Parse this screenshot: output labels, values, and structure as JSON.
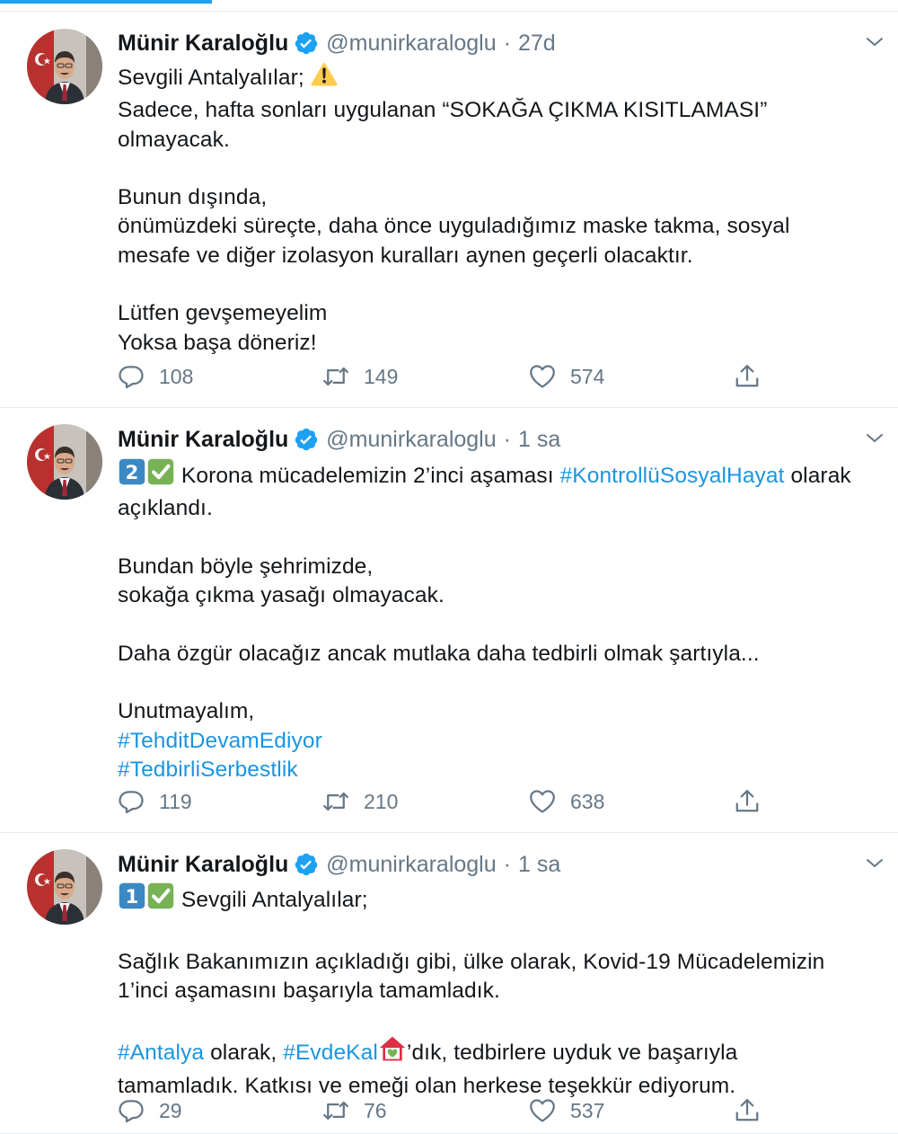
{
  "tweets": [
    {
      "name": "Münir Karaloğlu",
      "handle": "@munirkaraloglu",
      "separator": "·",
      "time": "27d",
      "lines": [
        [
          {
            "t": "Sevgili Antalyalılar; "
          },
          {
            "emoji": "warning-sign"
          }
        ],
        [
          {
            "t": "Sadece, hafta sonları uygulanan “SOKAĞA ÇIKMA KISITLAMASI”"
          }
        ],
        [
          {
            "t": "olmayacak."
          }
        ],
        [],
        [
          {
            "t": "Bunun dışında,"
          }
        ],
        [
          {
            "t": "önümüzdeki süreçte, daha önce uyguladığımız maske takma, sosyal"
          }
        ],
        [
          {
            "t": "mesafe ve diğer izolasyon kuralları aynen geçerli olacaktır."
          }
        ],
        [],
        [
          {
            "t": "Lütfen gevşemeyelim"
          }
        ],
        [
          {
            "t": "Yoksa başa döneriz!"
          }
        ]
      ],
      "replies": "108",
      "retweets": "149",
      "likes": "574"
    },
    {
      "name": "Münir Karaloğlu",
      "handle": "@munirkaraloglu",
      "separator": "·",
      "time": "1 sa",
      "lines": [
        [
          {
            "emoji": "keycap-2"
          },
          {
            "emoji": "check-mark"
          },
          {
            "t": " Korona mücadelemizin 2’inci aşaması "
          },
          {
            "tag": "#KontrollüSosyalHayat"
          },
          {
            "t": " olarak"
          }
        ],
        [
          {
            "t": "açıklandı."
          }
        ],
        [],
        [
          {
            "t": "Bundan böyle şehrimizde,"
          }
        ],
        [
          {
            "t": "sokağa çıkma yasağı olmayacak."
          }
        ],
        [],
        [
          {
            "t": "Daha özgür olacağız ancak mutlaka daha tedbirli olmak şartıyla..."
          }
        ],
        [],
        [
          {
            "t": "Unutmayalım,"
          }
        ],
        [
          {
            "tag": "#TehditDevamEdiyor"
          }
        ],
        [
          {
            "tag": "#TedbirliSerbestlik"
          }
        ]
      ],
      "replies": "119",
      "retweets": "210",
      "likes": "638"
    },
    {
      "name": "Münir Karaloğlu",
      "handle": "@munirkaraloglu",
      "separator": "·",
      "time": "1 sa",
      "lines": [
        [
          {
            "emoji": "keycap-1"
          },
          {
            "emoji": "check-mark"
          },
          {
            "t": " Sevgili Antalyalılar;"
          }
        ],
        [],
        [
          {
            "t": "Sağlık Bakanımızın açıkladığı gibi, ülke olarak, Kovid-19 Mücadelemizin"
          }
        ],
        [
          {
            "t": "1’inci aşamasını başarıyla tamamladık."
          }
        ],
        [],
        [
          {
            "tag": "#Antalya"
          },
          {
            "t": " olarak, "
          },
          {
            "tag": "#EvdeKal"
          },
          {
            "emoji": "house-with-heart"
          },
          {
            "t": "’dık, tedbirlere uyduk ve başarıyla"
          }
        ],
        [
          {
            "t": "tamamladık. Katkısı ve emeği olan herkese teşekkür ediyorum."
          }
        ]
      ],
      "replies": "29",
      "retweets": "76",
      "likes": "537"
    }
  ],
  "colors": {
    "text": "#14171a",
    "secondary": "#657786",
    "link": "#1b95e0",
    "verified": "#1da1f2",
    "divider": "#e6ecf0",
    "check_green": "#77b255",
    "keycap_blue": "#3b88c3"
  },
  "icons": [
    "verified-badge-icon",
    "chevron-down-icon",
    "reply-icon",
    "retweet-icon",
    "like-icon",
    "share-icon"
  ]
}
